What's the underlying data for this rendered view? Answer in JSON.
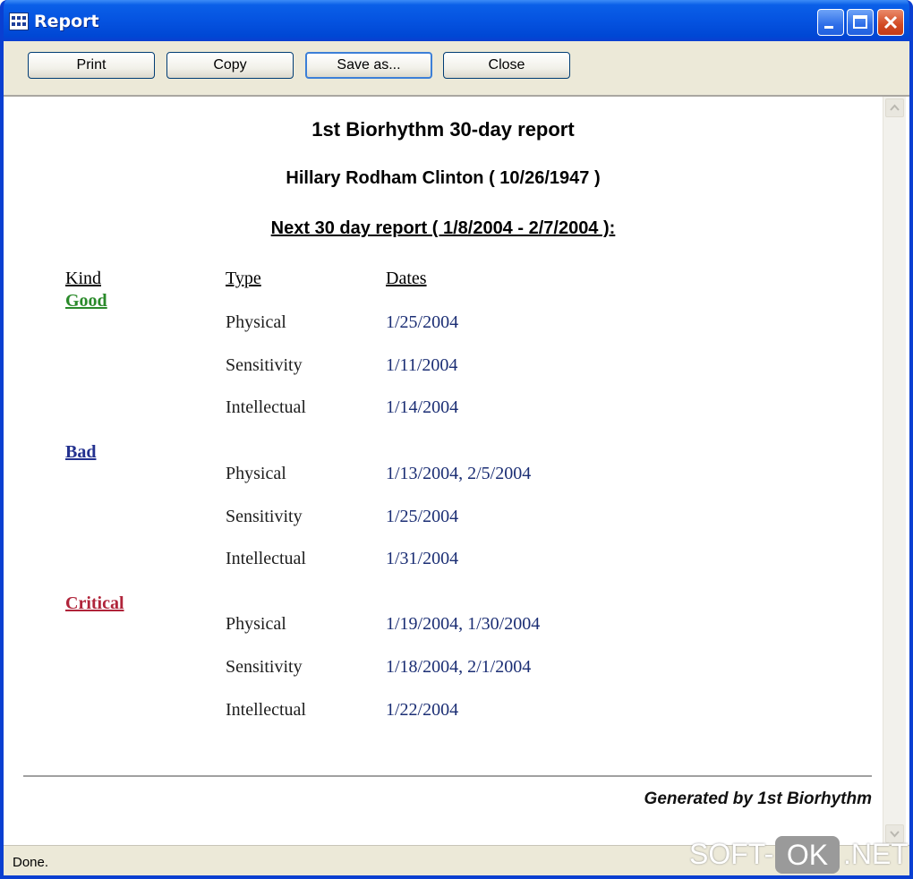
{
  "window": {
    "title": "Report"
  },
  "toolbar": {
    "print_label": "Print",
    "copy_label": "Copy",
    "save_as_label": "Save as...",
    "close_label": "Close"
  },
  "report": {
    "title": "1st Biorhythm 30-day report",
    "person": "Hillary Rodham Clinton ( 10/26/1947 )",
    "period": "Next 30 day report ( 1/8/2004 - 2/7/2004 ):",
    "headers": {
      "kind": "Kind",
      "type": "Type",
      "dates": "Dates"
    },
    "groups": [
      {
        "kind": "Good",
        "color": "#2a8a2a",
        "rows": [
          {
            "type": "Physical",
            "dates": "1/25/2004"
          },
          {
            "type": "Sensitivity",
            "dates": "1/11/2004"
          },
          {
            "type": "Intellectual",
            "dates": "1/14/2004"
          }
        ]
      },
      {
        "kind": "Bad",
        "color": "#23318f",
        "rows": [
          {
            "type": "Physical",
            "dates": "1/13/2004, 2/5/2004"
          },
          {
            "type": "Sensitivity",
            "dates": "1/25/2004"
          },
          {
            "type": "Intellectual",
            "dates": "1/31/2004"
          }
        ]
      },
      {
        "kind": "Critical",
        "color": "#b0243a",
        "rows": [
          {
            "type": "Physical",
            "dates": "1/19/2004, 1/30/2004"
          },
          {
            "type": "Sensitivity",
            "dates": "1/18/2004, 2/1/2004"
          },
          {
            "type": "Intellectual",
            "dates": "1/22/2004"
          }
        ]
      }
    ],
    "footer": "Generated by 1st Biorhythm"
  },
  "status": {
    "text": "Done."
  },
  "watermark": {
    "left": "SOFT-",
    "badge": "OK",
    "right": ".NET"
  }
}
